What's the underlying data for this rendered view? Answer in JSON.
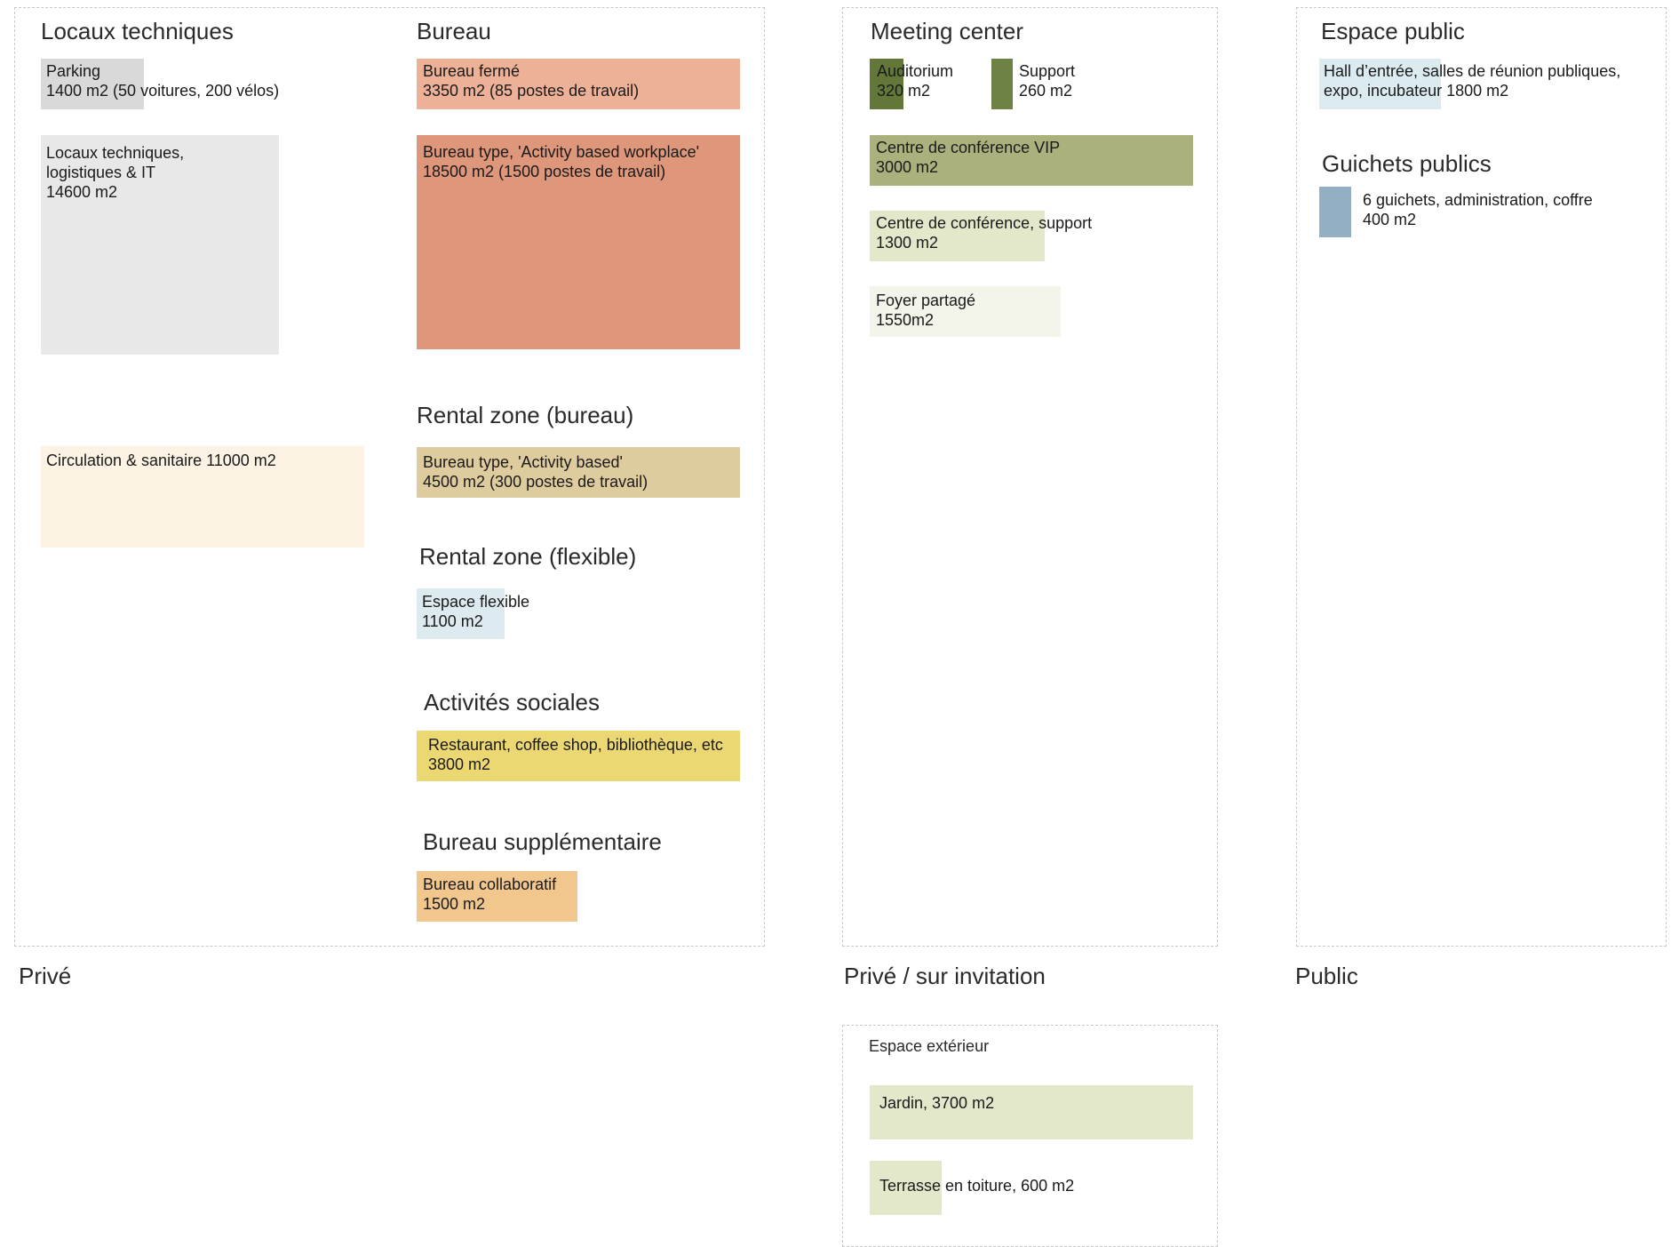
{
  "zones": {
    "prive": "Privé",
    "invitation": "Privé / sur invitation",
    "public": "Public"
  },
  "headings": {
    "locaux": "Locaux techniques",
    "bureau": "Bureau",
    "rental_bureau": "Rental zone (bureau)",
    "rental_flexible": "Rental zone (flexible)",
    "activites": "Activités sociales",
    "bureau_supp": "Bureau supplémentaire",
    "meeting": "Meeting center",
    "espace_public": "Espace public",
    "guichets": "Guichets publics",
    "exterieur": "Espace extérieur"
  },
  "spaces": {
    "parking": {
      "line1": "Parking",
      "line2": "1400 m2 (50 voitures, 200 vélos)",
      "color": "#d9d9d9"
    },
    "locaux_it": {
      "line1": "Locaux techniques,",
      "line2": "logistiques & IT",
      "line3": "14600 m2",
      "color": "#e8e8e8"
    },
    "circulation": {
      "line1": "Circulation & sanitaire 11000 m2",
      "color": "#fdf3e4"
    },
    "bureau_ferme": {
      "line1": "Bureau fermé",
      "line2": "3350 m2 (85 postes de travail)",
      "color": "#edb197"
    },
    "bureau_type": {
      "line1": "Bureau type, 'Activity based workplace'",
      "line2": "18500 m2 (1500 postes de travail)",
      "color": "#de977a"
    },
    "rental_bureau_type": {
      "line1": "Bureau type, 'Activity based'",
      "line2": "4500 m2 (300 postes de travail)",
      "color": "#dfcc9e"
    },
    "espace_flexible": {
      "line1": "Espace flexible",
      "line2": "1100 m2",
      "color": "#ddebf0"
    },
    "restaurant": {
      "line1": "Restaurant, coffee shop, bibliothèque, etc",
      "line2": "3800 m2",
      "color": "#ecd872"
    },
    "bureau_collab": {
      "line1": "Bureau collaboratif",
      "line2": "1500 m2",
      "color": "#f2c78e"
    },
    "auditorium": {
      "line1": "Auditorium",
      "line2": "320 m2",
      "color": "#637838"
    },
    "support": {
      "line1": "Support",
      "line2": "260 m2",
      "color": "#6d8243"
    },
    "conf_vip": {
      "line1": "Centre de conférence VIP",
      "line2": "3000 m2",
      "color": "#abb07c"
    },
    "conf_support": {
      "line1": "Centre de conférence, support",
      "line2": "1300 m2",
      "color": "#e3e8cb"
    },
    "foyer": {
      "line1": "Foyer partagé",
      "line2": "1550m2",
      "color": "#f3f4ea"
    },
    "hall": {
      "line1": "Hall d’entrée, salles de réunion publiques,",
      "line2": "expo, incubateur  1800 m2",
      "color": "#dbebf0"
    },
    "guichets": {
      "line1": "6 guichets, administration, coffre",
      "line2": "400 m2",
      "color": "#93afc3"
    },
    "jardin": {
      "line1": "Jardin, 3700 m2",
      "color": "#e3e8cb"
    },
    "terrasse": {
      "line1": "Terrasse en toiture, 600 m2",
      "color": "#e3e8cb"
    }
  }
}
